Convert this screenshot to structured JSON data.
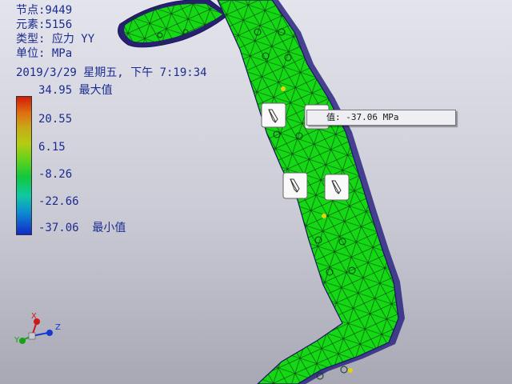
{
  "info": {
    "node_line": "节点:9449",
    "element_line": "元素:5156",
    "type_line": "类型: 应力 YY",
    "unit_line": "单位: MPa",
    "timestamp_line": "2019/3/29 星期五, 下午 7:19:34"
  },
  "legend": {
    "labels": [
      "34.95 最大值",
      "20.55",
      "6.15",
      "-8.26",
      "-22.66",
      "-37.06  最小值"
    ]
  },
  "probe": {
    "text": "值: -37.06 MPa"
  },
  "triad": {
    "x_label": "X",
    "y_label": "Y",
    "z_label": "Z"
  },
  "colors": {
    "label_text": "#1c2b8f",
    "mesh_fill": "#14d814",
    "mesh_line": "#0a3a14",
    "axis_x": "#d01818",
    "axis_y": "#18a018",
    "axis_z": "#1838d0"
  }
}
